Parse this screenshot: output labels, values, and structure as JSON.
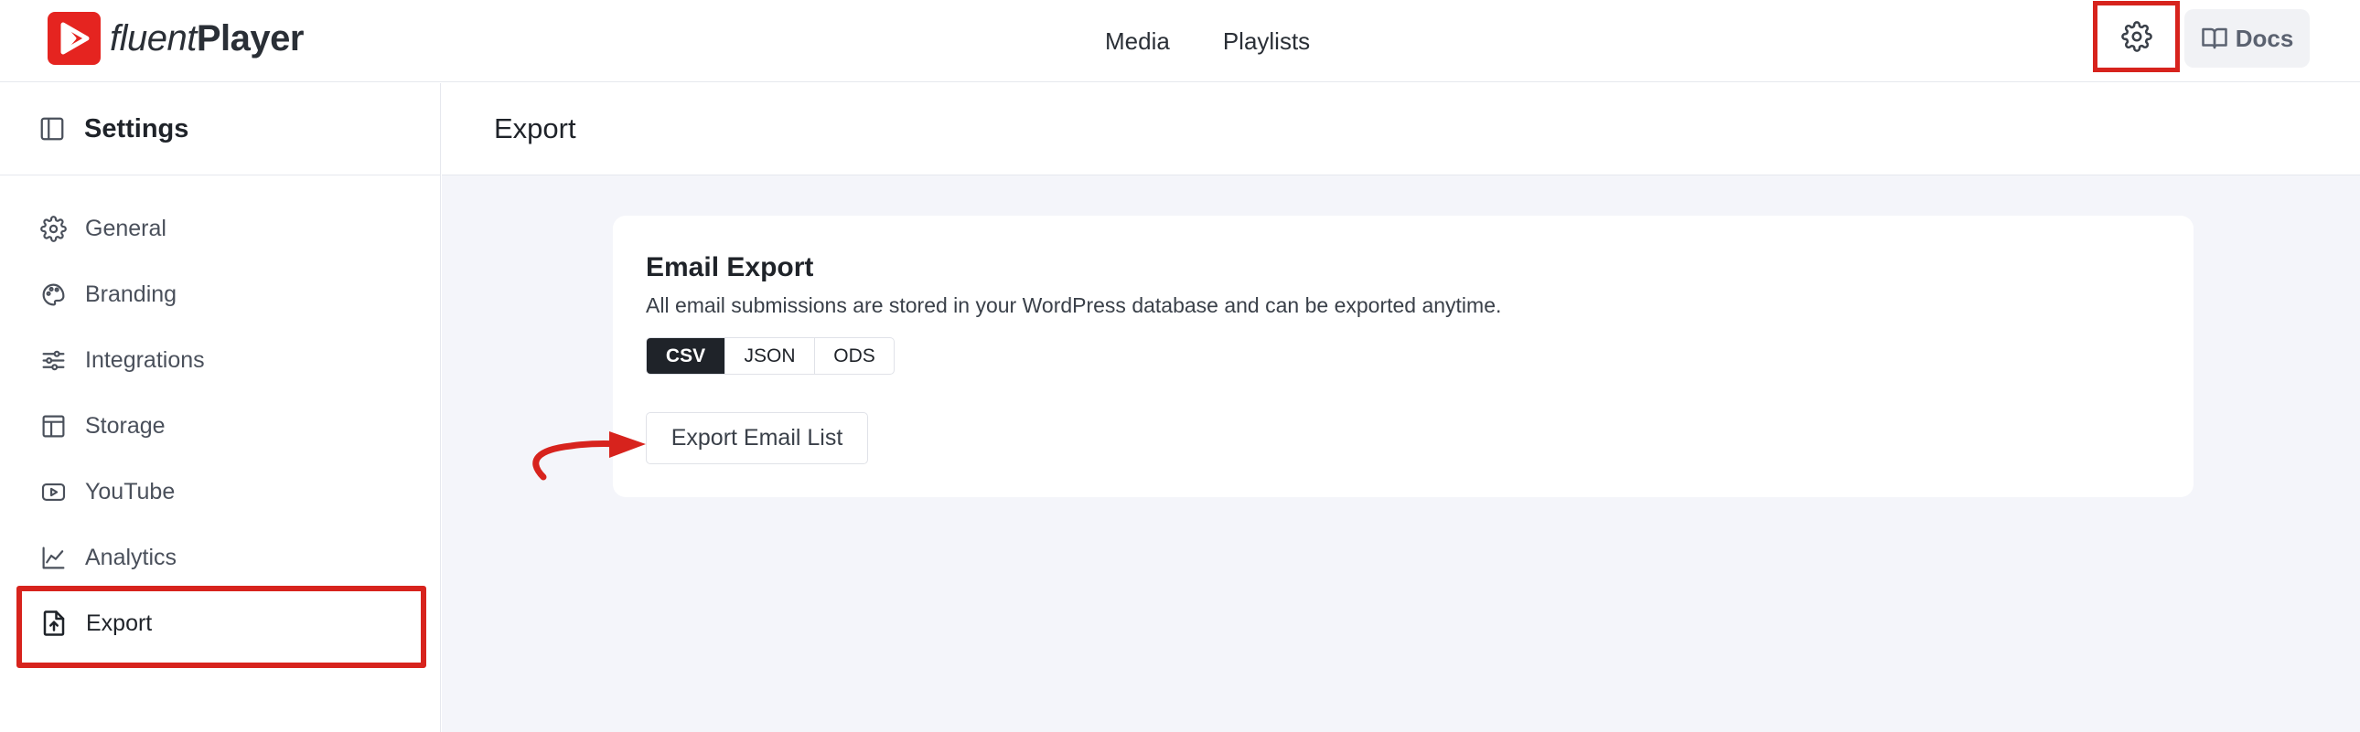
{
  "app": {
    "logo_text_light": "fluent",
    "logo_text_bold": "Player"
  },
  "topnav": {
    "items": [
      "Media",
      "Playlists"
    ]
  },
  "header_actions": {
    "settings_icon": "gear-icon",
    "docs_label": "Docs",
    "docs_icon": "book-icon"
  },
  "sidebar": {
    "title": "Settings",
    "items": [
      {
        "label": "General",
        "icon": "gear-icon"
      },
      {
        "label": "Branding",
        "icon": "palette-icon"
      },
      {
        "label": "Integrations",
        "icon": "sliders-icon"
      },
      {
        "label": "Storage",
        "icon": "storage-icon"
      },
      {
        "label": "YouTube",
        "icon": "youtube-icon"
      },
      {
        "label": "Analytics",
        "icon": "chart-line-icon"
      },
      {
        "label": "Export",
        "icon": "export-icon",
        "active": true
      }
    ]
  },
  "page": {
    "title": "Export"
  },
  "email_export": {
    "title": "Email Export",
    "description": "All email submissions are stored in your WordPress database and can be exported anytime.",
    "formats": [
      "CSV",
      "JSON",
      "ODS"
    ],
    "selected_format": "CSV",
    "button_label": "Export Email List"
  },
  "colors": {
    "brand_red": "#e52420",
    "highlight_red": "#d7231d",
    "selected_dark": "#1f2329",
    "content_bg": "#f4f5fa"
  }
}
